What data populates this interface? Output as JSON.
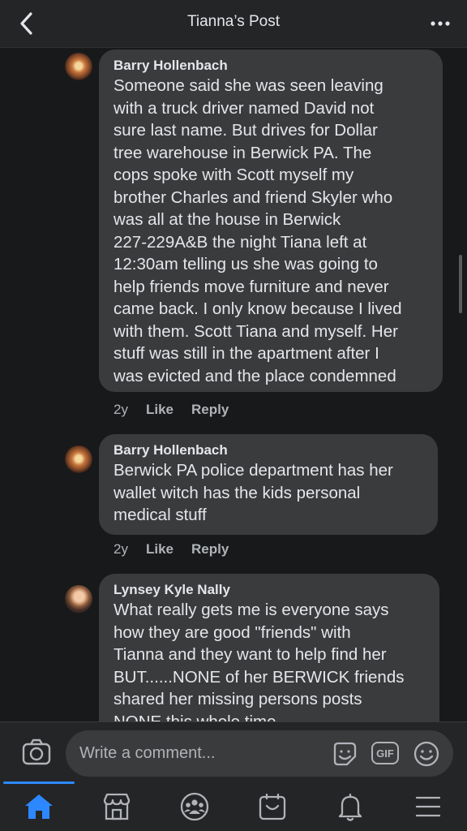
{
  "header": {
    "title": "Tianna’s Post"
  },
  "comments": [
    {
      "author": "Barry Hollenbach",
      "text": "Someone said she was seen leaving\nwith a truck driver named David not\nsure last name. But drives for Dollar\ntree warehouse in Berwick PA. The\ncops spoke with Scott myself my\nbrother Charles and friend Skyler who\nwas all at the house in Berwick\n227-229A&B the night Tiana left at\n12:30am telling us she was going to\nhelp friends move furniture and never\ncame back. I only know because I lived\nwith them. Scott Tiana and myself. Her\nstuff was still in the apartment after I\nwas evicted and the place condemned",
      "time": "2y",
      "like": "Like",
      "reply": "Reply"
    },
    {
      "author": "Barry Hollenbach",
      "text": "Berwick PA police department has her\nwallet witch has the kids personal\nmedical stuff",
      "time": "2y",
      "like": "Like",
      "reply": "Reply"
    },
    {
      "author": "Lynsey Kyle Nally",
      "text": "What really gets me is everyone says\nhow they are good \"friends\" with\nTianna and they want to help find her\nBUT......NONE of her BERWICK friends\nshared her missing persons posts\nNONE this whole time",
      "time": "",
      "like": "",
      "reply": ""
    }
  ],
  "composer": {
    "placeholder": "Write a comment..."
  },
  "icons": {
    "back": "chevron-left-icon",
    "more": "more-horizontal-icon",
    "camera": "camera-icon",
    "sticker": "sticker-icon",
    "gif": "gif-icon",
    "emoji": "emoji-icon",
    "tabs": [
      "home-icon",
      "marketplace-icon",
      "groups-icon",
      "shop-icon",
      "bell-icon",
      "menu-icon"
    ]
  },
  "gif_label": "GIF",
  "colors": {
    "background": "#18191a",
    "bubble": "#3a3b3c",
    "accent": "#2d88ff",
    "secondary_text": "#b0b3b8"
  }
}
